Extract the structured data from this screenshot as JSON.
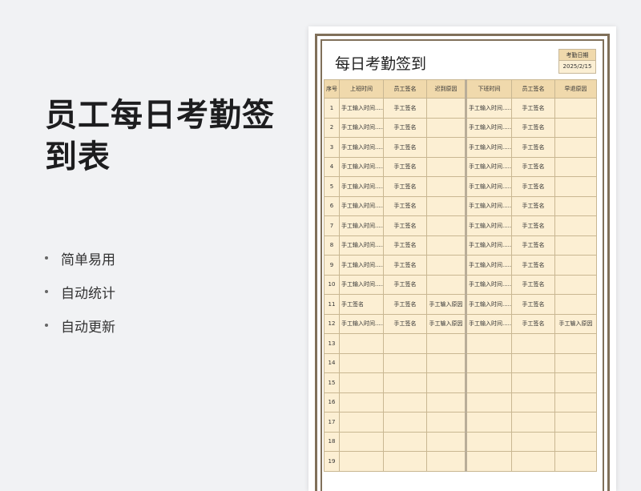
{
  "promo": {
    "title": "员工每日考勤签到表",
    "features": [
      "简单易用",
      "自动统计",
      "自动更新"
    ]
  },
  "sheet": {
    "title": "每日考勤签到",
    "date_label": "考勤日期",
    "date_value": "2025/2/15",
    "headers": [
      "序号",
      "上班时间",
      "员工签名",
      "迟到原因",
      "下班时间",
      "员工签名",
      "早退原因"
    ],
    "rows": [
      [
        "1",
        "手工输入时间......",
        "手工签名",
        "",
        "手工输入时间......",
        "手工签名",
        ""
      ],
      [
        "2",
        "手工输入时间......",
        "手工签名",
        "",
        "手工输入时间......",
        "手工签名",
        ""
      ],
      [
        "3",
        "手工输入时间......",
        "手工签名",
        "",
        "手工输入时间......",
        "手工签名",
        ""
      ],
      [
        "4",
        "手工输入时间......",
        "手工签名",
        "",
        "手工输入时间......",
        "手工签名",
        ""
      ],
      [
        "5",
        "手工输入时间......",
        "手工签名",
        "",
        "手工输入时间......",
        "手工签名",
        ""
      ],
      [
        "6",
        "手工输入时间......",
        "手工签名",
        "",
        "手工输入时间......",
        "手工签名",
        ""
      ],
      [
        "7",
        "手工输入时间......",
        "手工签名",
        "",
        "手工输入时间......",
        "手工签名",
        ""
      ],
      [
        "8",
        "手工输入时间......",
        "手工签名",
        "",
        "手工输入时间......",
        "手工签名",
        ""
      ],
      [
        "9",
        "手工输入时间......",
        "手工签名",
        "",
        "手工输入时间......",
        "手工签名",
        ""
      ],
      [
        "10",
        "手工输入时间......",
        "手工签名",
        "",
        "手工输入时间......",
        "手工签名",
        ""
      ],
      [
        "11",
        "手工签名",
        "手工签名",
        "手工输入原因",
        "手工输入时间......",
        "手工签名",
        ""
      ],
      [
        "12",
        "手工输入时间......",
        "手工签名",
        "手工输入原因",
        "手工输入时间......",
        "手工签名",
        "手工输入原因"
      ],
      [
        "13",
        "",
        "",
        "",
        "",
        "",
        ""
      ],
      [
        "14",
        "",
        "",
        "",
        "",
        "",
        ""
      ],
      [
        "15",
        "",
        "",
        "",
        "",
        "",
        ""
      ],
      [
        "16",
        "",
        "",
        "",
        "",
        "",
        ""
      ],
      [
        "17",
        "",
        "",
        "",
        "",
        "",
        ""
      ],
      [
        "18",
        "",
        "",
        "",
        "",
        "",
        ""
      ],
      [
        "19",
        "",
        "",
        "",
        "",
        "",
        ""
      ]
    ]
  }
}
